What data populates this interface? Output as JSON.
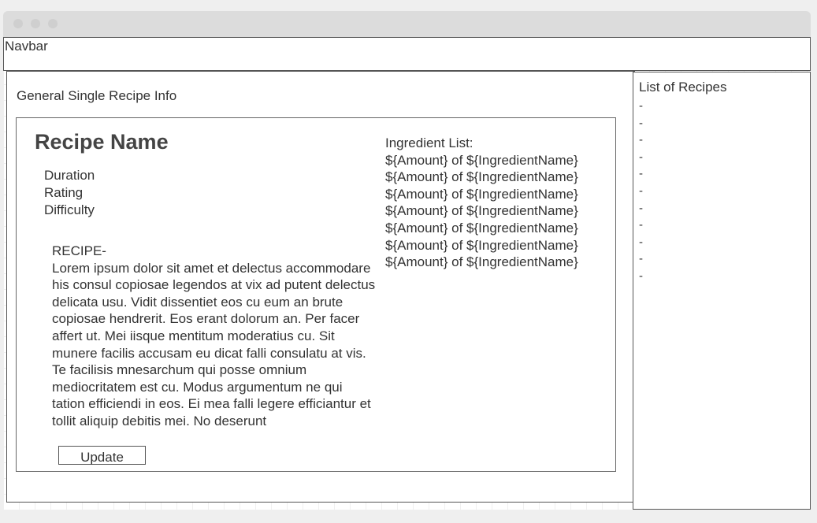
{
  "navbar": {
    "label": "Navbar"
  },
  "main": {
    "section_title": "General Single Recipe Info",
    "recipe": {
      "name": "Recipe Name",
      "meta": [
        "Duration",
        "Rating",
        "Difficulty"
      ],
      "recipe_heading": "RECIPE-",
      "recipe_body": "Lorem ipsum dolor sit amet et delectus accommodare his consul copiosae legendos at vix ad putent delectus delicata usu. Vidit dissentiet eos cu eum an brute copiosae hendrerit. Eos erant dolorum an. Per facer affert ut. Mei iisque mentitum moderatius cu. Sit munere facilis accusam eu dicat falli consulatu at vis. Te facilisis mnesarchum qui posse omnium mediocritatem est cu. Modus argumentum ne qui tation efficiendi in eos. Ei mea falli legere efficiantur et tollit aliquip debitis mei. No deserunt",
      "update_label": "Update"
    },
    "ingredients": {
      "title": "Ingredient List:",
      "items": [
        "${Amount} of ${IngredientName}",
        "${Amount} of ${IngredientName}",
        "${Amount} of ${IngredientName}",
        "${Amount} of ${IngredientName}",
        "${Amount} of ${IngredientName}",
        "${Amount} of ${IngredientName}",
        "${Amount} of ${IngredientName}"
      ]
    }
  },
  "sidebar": {
    "title": "List of Recipes",
    "items": [
      "-",
      "-",
      "-",
      "-",
      "-",
      "-",
      "-",
      "-",
      "-",
      "-",
      "-"
    ]
  }
}
